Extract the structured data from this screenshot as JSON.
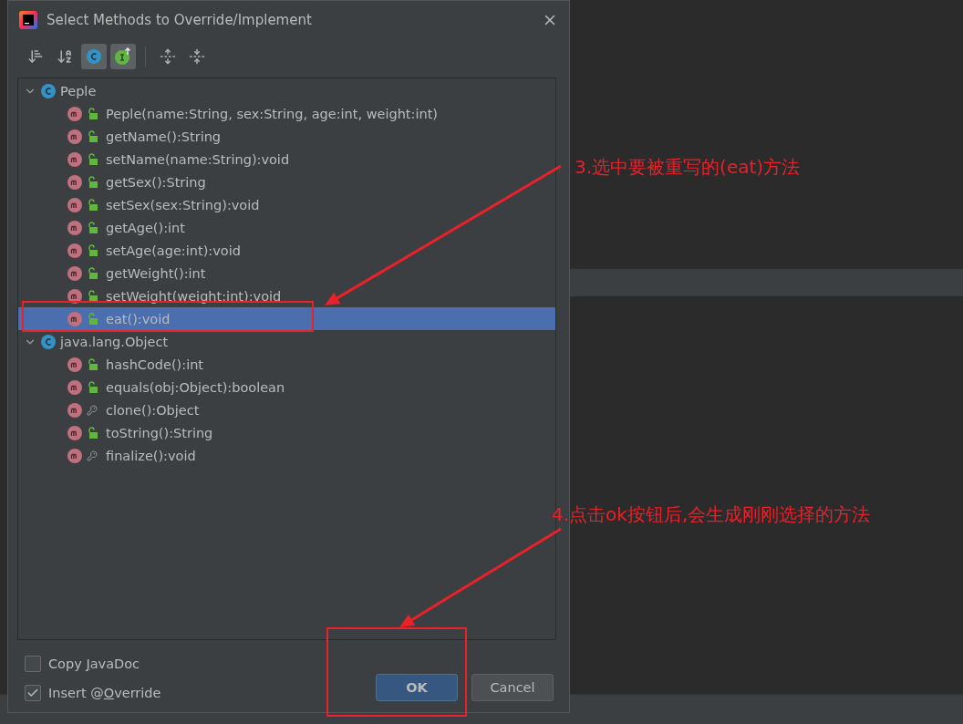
{
  "dialog": {
    "title": "Select Methods to Override/Implement",
    "toolbar": [
      {
        "kind": "sort-visibility",
        "selected": false
      },
      {
        "kind": "sort-alpha",
        "selected": false
      },
      {
        "kind": "show-classes",
        "selected": true
      },
      {
        "kind": "show-interfaces",
        "selected": true
      },
      {
        "kind": "expand-all",
        "selected": false
      },
      {
        "kind": "collapse-all",
        "selected": false
      }
    ],
    "tree": [
      {
        "label": "Peple",
        "expanded": true,
        "selected": false,
        "children": [
          {
            "label": "Peple(name:String, sex:String, age:int, weight:int)",
            "kind": "public",
            "selected": false
          },
          {
            "label": "getName():String",
            "kind": "public",
            "selected": false
          },
          {
            "label": "setName(name:String):void",
            "kind": "public",
            "selected": false
          },
          {
            "label": "getSex():String",
            "kind": "public",
            "selected": false
          },
          {
            "label": "setSex(sex:String):void",
            "kind": "public",
            "selected": false
          },
          {
            "label": "getAge():int",
            "kind": "public",
            "selected": false
          },
          {
            "label": "setAge(age:int):void",
            "kind": "public",
            "selected": false
          },
          {
            "label": "getWeight():int",
            "kind": "public",
            "selected": false
          },
          {
            "label": "setWeight(weight:int):void",
            "kind": "public",
            "selected": false
          },
          {
            "label": "eat():void",
            "kind": "public",
            "selected": true
          }
        ]
      },
      {
        "label": "java.lang.Object",
        "expanded": true,
        "selected": false,
        "children": [
          {
            "label": "hashCode():int",
            "kind": "public",
            "selected": false
          },
          {
            "label": "equals(obj:Object):boolean",
            "kind": "public",
            "selected": false
          },
          {
            "label": "clone():Object",
            "kind": "protected",
            "selected": false
          },
          {
            "label": "toString():String",
            "kind": "public",
            "selected": false
          },
          {
            "label": "finalize():void",
            "kind": "protected",
            "selected": false
          }
        ]
      }
    ],
    "options": [
      {
        "before": "Copy ",
        "mnemonic": "J",
        "after": "avaDoc",
        "checked": false
      },
      {
        "before": "Insert @",
        "mnemonic": "O",
        "after": "verride",
        "checked": true
      }
    ],
    "buttons": [
      {
        "label": "OK",
        "kind": "primary"
      },
      {
        "label": "Cancel",
        "kind": "secondary"
      }
    ]
  },
  "annotations": [
    {
      "text": "3.选中要被重写的(eat)方法"
    },
    {
      "text": "4.点击ok按钮后,会生成刚刚选择的方法"
    }
  ]
}
